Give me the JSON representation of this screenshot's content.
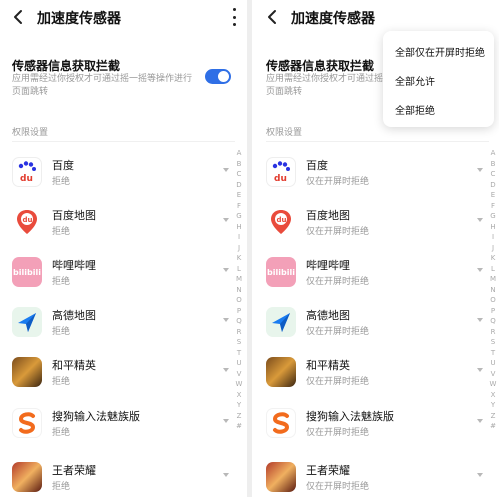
{
  "header": {
    "title": "加速度传感器"
  },
  "block": {
    "title": "传感器信息获取拦截",
    "description": "应用需经过你授权才可通过摇一摇等操作进行页面跳转",
    "toggle_on": true
  },
  "section_label": "权限设置",
  "apps": [
    {
      "name": "百度",
      "icon": "baidu-icon"
    },
    {
      "name": "百度地图",
      "icon": "baidu-map-icon"
    },
    {
      "name": "哔哩哔哩",
      "icon": "bilibili-icon"
    },
    {
      "name": "高德地图",
      "icon": "gaode-map-icon"
    },
    {
      "name": "和平精英",
      "icon": "peace-elite-icon"
    },
    {
      "name": "搜狗输入法魅族版",
      "icon": "sogou-icon"
    },
    {
      "name": "王者荣耀",
      "icon": "honor-of-kings-icon"
    }
  ],
  "left_statuses": [
    "拒绝",
    "拒绝",
    "拒绝",
    "拒绝",
    "拒绝",
    "拒绝",
    "拒绝"
  ],
  "right_statuses": [
    "仅在开屏时拒绝",
    "仅在开屏时拒绝",
    "仅在开屏时拒绝",
    "仅在开屏时拒绝",
    "仅在开屏时拒绝",
    "仅在开屏时拒绝",
    "仅在开屏时拒绝"
  ],
  "alphabet_index": [
    "A",
    "B",
    "C",
    "D",
    "E",
    "F",
    "G",
    "H",
    "I",
    "J",
    "K",
    "L",
    "M",
    "N",
    "O",
    "P",
    "Q",
    "R",
    "S",
    "T",
    "U",
    "V",
    "W",
    "X",
    "Y",
    "Z",
    "#"
  ],
  "dropdown_menu": {
    "items": [
      "全部仅在开屏时拒绝",
      "全部允许",
      "全部拒绝"
    ]
  },
  "icon_labels": {
    "baidu": "du",
    "baidu_map": "du",
    "bilibili": "bilibili"
  },
  "colors": {
    "toggle_on": "#2f6fe6",
    "baidu_blue": "#2932e1",
    "baidu_map_red": "#e94b3c",
    "bilibili_pink": "#f3a0b8",
    "sogou_orange": "#f26b1d"
  }
}
